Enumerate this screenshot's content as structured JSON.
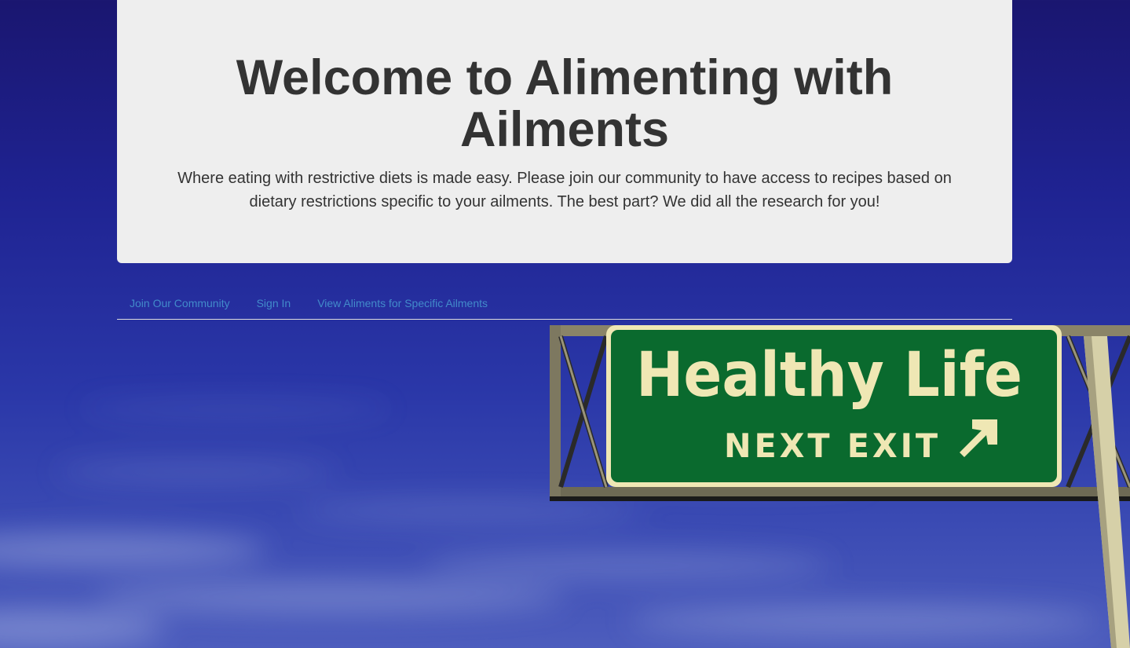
{
  "hero": {
    "title": "Welcome to Alimenting with Ailments",
    "description": "Where eating with restrictive diets is made easy. Please join our community to have access to recipes based on dietary restrictions specific to your ailments. The best part? We did all the research for you!"
  },
  "nav": {
    "items": [
      {
        "label": "Join Our Community"
      },
      {
        "label": "Sign In"
      },
      {
        "label": "View Aliments for Specific Ailments"
      }
    ]
  },
  "background_image": {
    "sign_line1": "Healthy Life",
    "sign_line2": "NEXT EXIT",
    "sign_arrow_icon": "arrow-up-right-icon"
  },
  "colors": {
    "sky": "#1f2392",
    "panel": "#eeeeee",
    "link": "#428bca",
    "sign_green": "#0a6a2e",
    "sign_text": "#efe7b4"
  }
}
